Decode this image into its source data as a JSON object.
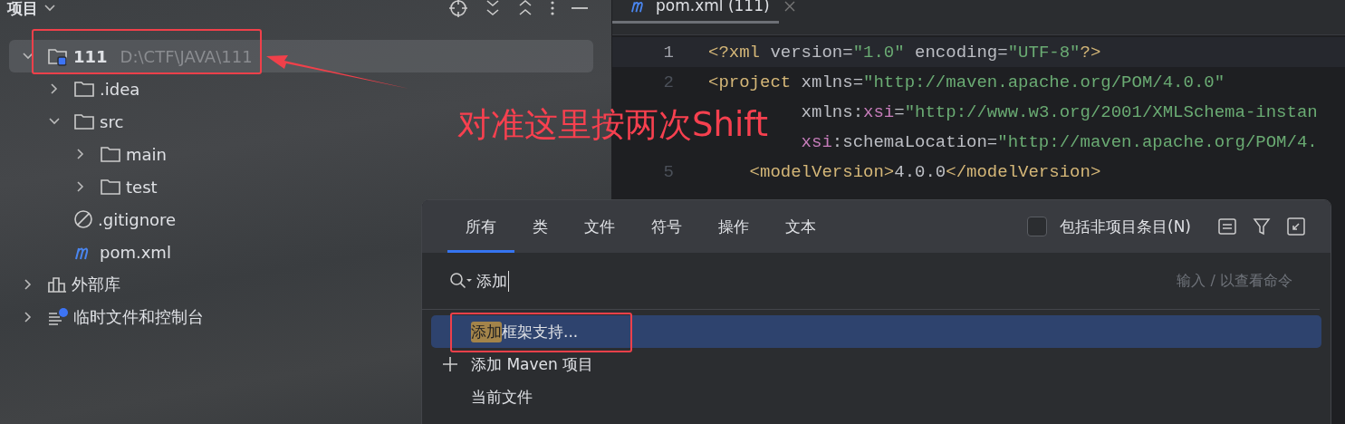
{
  "project_panel": {
    "title": "项目",
    "tree": [
      {
        "label": "111",
        "path": "D:\\CTF\\JAVA\\111",
        "kind": "module",
        "expanded": true,
        "selected": true,
        "children": [
          {
            "label": ".idea",
            "kind": "folder",
            "expanded": false,
            "selected": false
          },
          {
            "label": "src",
            "kind": "folder",
            "expanded": true,
            "selected": false,
            "children": [
              {
                "label": "main",
                "kind": "folder",
                "expanded": false,
                "selected": false
              },
              {
                "label": "test",
                "kind": "folder",
                "expanded": false,
                "selected": false
              }
            ]
          },
          {
            "label": ".gitignore",
            "kind": "ignore",
            "selected": false
          },
          {
            "label": "pom.xml",
            "kind": "maven",
            "selected": false
          }
        ]
      },
      {
        "label": "外部库",
        "kind": "library",
        "expanded": false,
        "selected": false
      },
      {
        "label": "临时文件和控制台",
        "kind": "scratch",
        "expanded": false,
        "selected": false
      }
    ]
  },
  "editor": {
    "tab": {
      "label": "pom.xml (111)"
    },
    "lines": [
      {
        "number": "1",
        "current": true,
        "tokens": [
          {
            "kind": "tag",
            "text": "<?xml"
          },
          {
            "kind": "attr",
            "text": " version="
          },
          {
            "kind": "str",
            "text": "\"1.0\""
          },
          {
            "kind": "attr",
            "text": " encoding="
          },
          {
            "kind": "str",
            "text": "\"UTF-8\""
          },
          {
            "kind": "tag",
            "text": "?>"
          }
        ]
      },
      {
        "number": "2",
        "current": false,
        "tokens": [
          {
            "kind": "tag",
            "text": "<project"
          },
          {
            "kind": "attr",
            "text": " xmlns="
          },
          {
            "kind": "str",
            "text": "\"http://maven.apache.org/POM/4.0.0\""
          }
        ]
      },
      {
        "current": false,
        "tokens": [
          {
            "kind": "attr",
            "text": "         xmlns:"
          },
          {
            "kind": "ns",
            "text": "xsi"
          },
          {
            "kind": "attr",
            "text": "="
          },
          {
            "kind": "str",
            "text": "\"http://www.w3.org/2001/XMLSchema-instan"
          }
        ]
      },
      {
        "current": false,
        "tokens": [
          {
            "kind": "ns",
            "text": "         xsi"
          },
          {
            "kind": "attr",
            "text": ":schemaLocation="
          },
          {
            "kind": "str",
            "text": "\"http://maven.apache.org/POM/4."
          }
        ]
      },
      {
        "number": "5",
        "current": false,
        "tokens": [
          {
            "kind": "tag",
            "text": "    <modelVersion>"
          },
          {
            "kind": "attr",
            "text": "4.0.0"
          },
          {
            "kind": "tag",
            "text": "</modelVersion>"
          }
        ]
      }
    ]
  },
  "search_popup": {
    "tabs": [
      {
        "label": "所有",
        "selected": true
      },
      {
        "label": "类",
        "selected": false
      },
      {
        "label": "文件",
        "selected": false
      },
      {
        "label": "符号",
        "selected": false
      },
      {
        "label": "操作",
        "selected": false
      },
      {
        "label": "文本",
        "selected": false
      }
    ],
    "checkbox": {
      "label": "包括非项目条目(N)",
      "checked": false
    },
    "query": "添加",
    "hint": "输入 / 以查看命令",
    "results": [
      {
        "kind": "action",
        "match": "添加",
        "text": "框架支持...",
        "selected": true
      },
      {
        "kind": "new",
        "text": "添加 Maven 项目",
        "selected": false
      },
      {
        "kind": "action",
        "text": "当前文件",
        "selected": false
      }
    ]
  },
  "annotation": {
    "note": "对准这里按两次Shift"
  }
}
